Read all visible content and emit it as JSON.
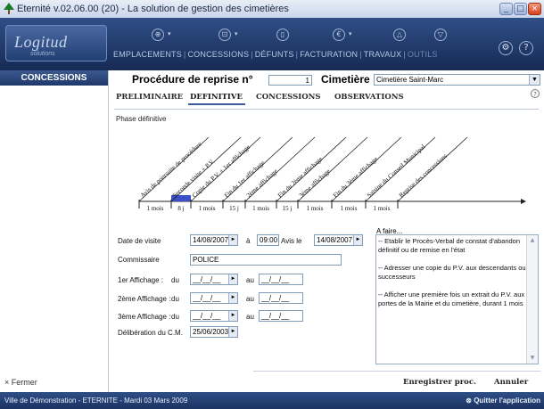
{
  "window": {
    "title": "Eternité v.02.06.00 (20) - La solution de gestion des cimetières"
  },
  "logo": {
    "name": "Logitud",
    "tagline": "solutions"
  },
  "nav": {
    "items": [
      "EMPLACEMENTS",
      "CONCESSIONS",
      "DÉFUNTS",
      "FACTURATION",
      "TRAVAUX",
      "OUTILS"
    ],
    "separator": "|"
  },
  "sidebar": {
    "title": "CONCESSIONS",
    "close_label": "× Fermer"
  },
  "header": {
    "procedure_label": "Procédure de reprise n°",
    "procedure_number": "1",
    "cemetery_label": "Cimetière",
    "cemetery_value": "Cimetière Saint-Marc"
  },
  "tabs": [
    {
      "label": "PRELIMINAIRE",
      "active": false
    },
    {
      "label": "DEFINITIVE",
      "active": true
    },
    {
      "label": "CONCESSIONS",
      "active": false
    },
    {
      "label": "OBSERVATIONS",
      "active": false
    }
  ],
  "help": "?",
  "phase_label": "Phase définitive",
  "timeline": {
    "steps": [
      "Avis de poursuite de procédure",
      "Seconde visite + P.V.",
      "Copie du P.V. + 1er affichage",
      "Fin du 1er affichage",
      "2ème affichage",
      "Fin du 2ème affichage",
      "3ème affichage",
      "Fin du 3ème affichage",
      "Saisine du Conseil Municipal",
      "Reprise des concessions"
    ],
    "durations": [
      "1 mois",
      "8 j",
      "1 mois",
      "15 j",
      "1 mois",
      "15 j",
      "1 mois",
      "1 mois",
      "1 mois"
    ],
    "highlighted_segment": 1,
    "highlight_color": "#3b4fc9"
  },
  "form": {
    "visit_date_label": "Date de visite",
    "visit_date": "14/08/2007",
    "at_label": "à",
    "visit_time": "09:00",
    "notice_label": "Avis le",
    "notice_date": "14/08/2007",
    "commissioner_label": "Commissaire",
    "commissioner": "POLICE",
    "aff1_label": "1er Affichage :",
    "aff2_label": "2ème Affichage :",
    "aff3_label": "3ème Affichage :",
    "from_label": "du",
    "to_label": "au",
    "empty_date": "__/__/__",
    "deliberation_label": "Délibération du C.M.",
    "deliberation_date": "25/06/2003"
  },
  "todo": {
    "title": "A faire...",
    "items": [
      "-- Etablir le Procès-Verbal de constat d'abandon définitif ou de remise en l'état",
      "-- Adresser une copie du P.V. aux descendants ou successeurs",
      "-- Afficher une première fois un extrait du P.V. aux portes de la Mairie et du cimetière, durant 1 mois"
    ]
  },
  "actions": {
    "save": "Enregistrer proc.",
    "cancel": "Annuler"
  },
  "status": {
    "left": "Ville de Démonstration - ETERNITE - Mardi 03 Mars 2009",
    "right": "Quitter l'application"
  },
  "colors": {
    "banner": "#223e72",
    "accent": "#3b5a99"
  }
}
